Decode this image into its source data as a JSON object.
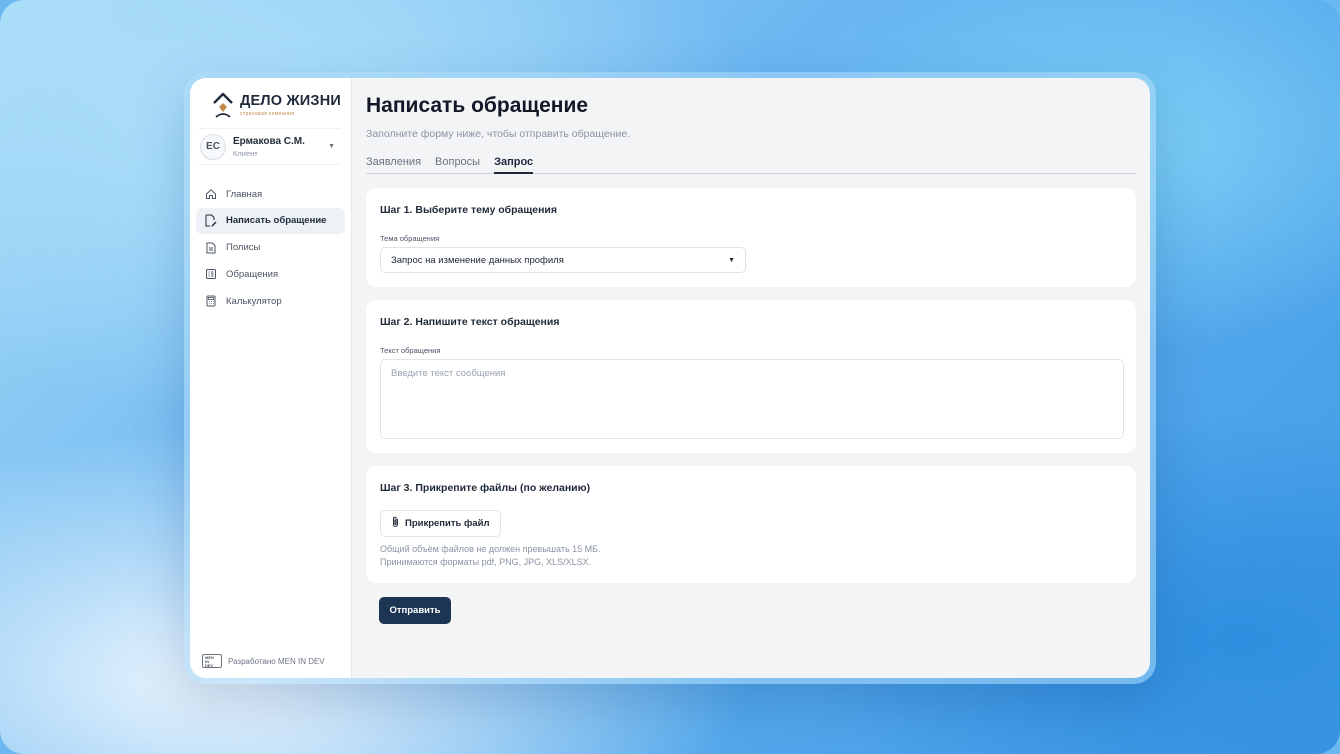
{
  "app": {
    "logo_title": "ДЕЛО ЖИЗНИ",
    "logo_subtitle": "страховая компания"
  },
  "user": {
    "initials": "ЕС",
    "name": "Ермакова С.М.",
    "role": "Клиент"
  },
  "sidebar": {
    "items": [
      {
        "label": "Главная",
        "icon": "home-icon",
        "active": false
      },
      {
        "label": "Написать обращение",
        "icon": "edit-document-icon",
        "active": true
      },
      {
        "label": "Полисы",
        "icon": "document-icon",
        "active": false
      },
      {
        "label": "Обращения",
        "icon": "list-icon",
        "active": false
      },
      {
        "label": "Калькулятор",
        "icon": "calculator-icon",
        "active": false
      }
    ],
    "footer": "Разработано MEN IN DEV",
    "footer_logo": [
      "MEN",
      "IN",
      "DEV"
    ]
  },
  "page": {
    "title": "Написать обращение",
    "subtitle": "Заполните форму ниже, чтобы отправить обращение."
  },
  "tabs": [
    {
      "label": "Заявления",
      "active": false
    },
    {
      "label": "Вопросы",
      "active": false
    },
    {
      "label": "Запрос",
      "active": true
    }
  ],
  "step1": {
    "title": "Шаг 1. Выберите тему обращения",
    "label": "Тема обращения",
    "selected": "Запрос на изменение данных профиля"
  },
  "step2": {
    "title": "Шаг 2. Напишите текст обращения",
    "label": "Текст обращения",
    "placeholder": "Введите текст сообщения"
  },
  "step3": {
    "title": "Шаг 3. Прикрепите файлы (по желанию)",
    "attach_label": "Прикрепить файл",
    "hint1": "Общий объём файлов не должен превышать 15 МБ.",
    "hint2": "Принимаются форматы pdf, PNG, JPG, XLS/XLSX."
  },
  "submit_label": "Отправить",
  "colors": {
    "accent": "#1c3552",
    "active_nav_bg": "#eef1f6",
    "background": "#f3f4f6"
  }
}
